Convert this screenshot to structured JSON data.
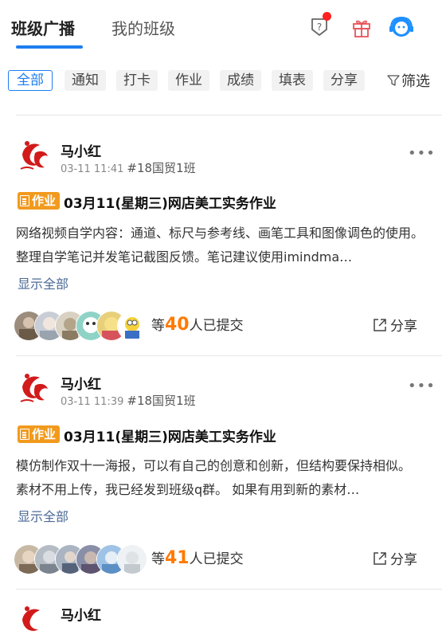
{
  "tabs": {
    "active": "班级广播",
    "inactive": "我的班级"
  },
  "filters": {
    "chips": [
      "全部",
      "通知",
      "打卡",
      "作业",
      "成绩",
      "填表",
      "分享"
    ],
    "filter_label": "筛选"
  },
  "posts": [
    {
      "author": "马小红",
      "time": "03-11 11:41",
      "class": "#18国贸1班",
      "badge": "作业",
      "title": "03月11(星期三)网店美工实务作业",
      "body": "网络视频自学内容：通道、标尺与参考线、画笔工具和图像调色的使用。整理自学笔记并发笔记截图反馈。笔记建议使用imindma…",
      "show_all": "显示全部",
      "submitted_prefix": "等",
      "submitted_count": "40",
      "submitted_suffix": "人已提交",
      "share_label": "分享"
    },
    {
      "author": "马小红",
      "time": "03-11 11:39",
      "class": "#18国贸1班",
      "badge": "作业",
      "title": "03月11(星期三)网店美工实务作业",
      "body": "模仿制作双十一海报，可以有自己的创意和创新，但结构要保持相似。 素材不用上传，我已经发到班级q群。 如果有用到新的素材…",
      "show_all": "显示全部",
      "submitted_prefix": "等",
      "submitted_count": "41",
      "submitted_suffix": "人已提交",
      "share_label": "分享"
    },
    {
      "author": "马小红"
    }
  ],
  "colors": {
    "accent": "#1e7ef0",
    "badge": "#f19a1d",
    "count": "#ff7a00",
    "link": "#4b6a95",
    "notify_dot": "#ff2020"
  },
  "icons": [
    "help-shield-icon",
    "gift-icon",
    "customer-service-icon",
    "filter-funnel-icon",
    "more-dots-icon",
    "share-icon"
  ]
}
